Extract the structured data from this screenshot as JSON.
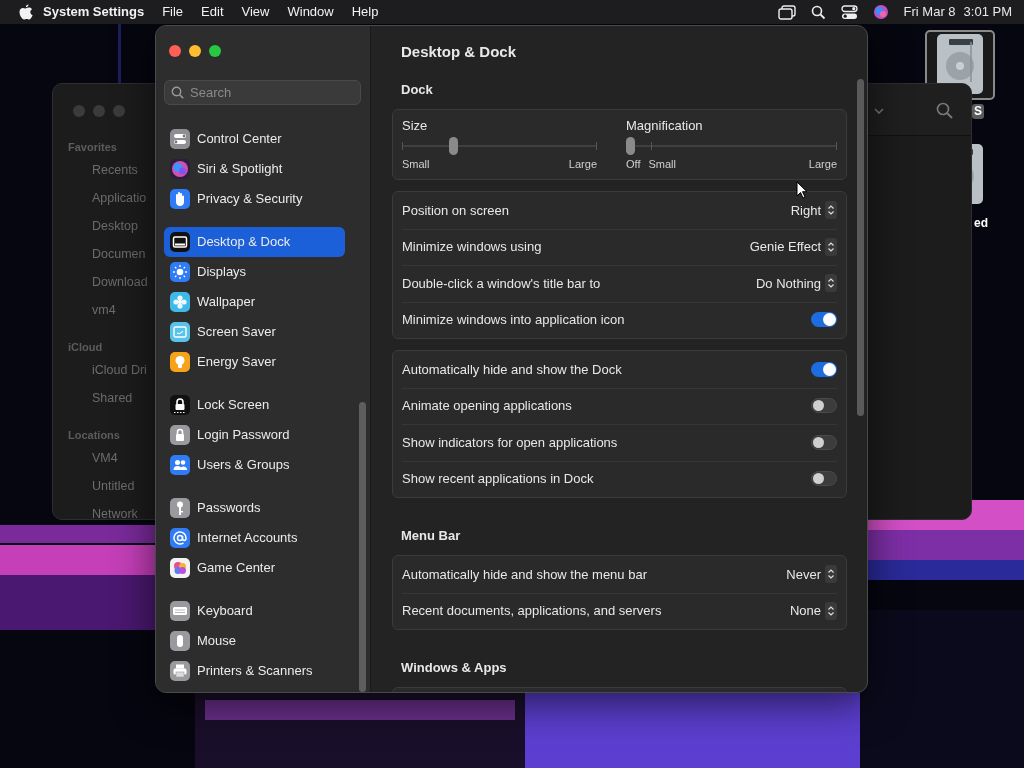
{
  "menu_bar": {
    "app": "System Settings",
    "menus": [
      "File",
      "Edit",
      "View",
      "Window",
      "Help"
    ],
    "date": "Fri Mar 8",
    "time": "3:01 PM"
  },
  "desktop_icons": [
    {
      "label": "S",
      "selected": true
    },
    {
      "label": "ed",
      "selected": false
    }
  ],
  "finder": {
    "sidebar": [
      {
        "heading": "Favorites",
        "items": [
          "Recents",
          "Applicatio",
          "Desktop",
          "Documen",
          "Download",
          "vm4"
        ]
      },
      {
        "heading": "iCloud",
        "items": [
          "iCloud Dri",
          "Shared"
        ]
      },
      {
        "heading": "Locations",
        "items": [
          "VM4",
          "Untitled",
          "Network"
        ]
      }
    ]
  },
  "settings": {
    "search": {
      "placeholder": "Search"
    },
    "sidebar": {
      "groups": [
        {
          "items": [
            {
              "label": "Control Center",
              "color": "#8e8e93",
              "selected": false
            },
            {
              "label": "Siri & Spotlight",
              "color": "#2a1f3d",
              "selected": false
            },
            {
              "label": "Privacy & Security",
              "color": "#2f7cf6",
              "selected": false
            }
          ]
        },
        {
          "items": [
            {
              "label": "Desktop & Dock",
              "color": "#111111",
              "selected": true
            },
            {
              "label": "Displays",
              "color": "#2f7cf6",
              "selected": false
            },
            {
              "label": "Wallpaper",
              "color": "#3fb9e8",
              "selected": false
            },
            {
              "label": "Screen Saver",
              "color": "#56c3ea",
              "selected": false
            },
            {
              "label": "Energy Saver",
              "color": "#f7a21b",
              "selected": false
            }
          ]
        },
        {
          "items": [
            {
              "label": "Lock Screen",
              "color": "#111111",
              "selected": false
            },
            {
              "label": "Login Password",
              "color": "#9a9a9e",
              "selected": false
            },
            {
              "label": "Users & Groups",
              "color": "#2f7cf6",
              "selected": false
            }
          ]
        },
        {
          "items": [
            {
              "label": "Passwords",
              "color": "#9a9a9e",
              "selected": false
            },
            {
              "label": "Internet Accounts",
              "color": "#2f7cf6",
              "selected": false
            },
            {
              "label": "Game Center",
              "color": "#f2f2f2",
              "selected": false
            }
          ]
        },
        {
          "items": [
            {
              "label": "Keyboard",
              "color": "#9a9a9e",
              "selected": false
            },
            {
              "label": "Mouse",
              "color": "#9a9a9e",
              "selected": false
            },
            {
              "label": "Printers & Scanners",
              "color": "#9a9a9e",
              "selected": false
            }
          ]
        }
      ]
    },
    "title": "Desktop & Dock",
    "sections": [
      {
        "heading": "Dock",
        "groups": [
          {
            "kind": "sliders",
            "sliders": [
              {
                "label": "Size",
                "level": 0.25,
                "labels": [
                  "Small",
                  "Large"
                ]
              },
              {
                "label": "Magnification",
                "level": 0,
                "labels": [
                  "Off",
                  "Small",
                  "Large"
                ]
              }
            ]
          },
          {
            "kind": "rows",
            "rows": [
              {
                "kind": "popup",
                "label": "Position on screen",
                "value": "Right"
              },
              {
                "kind": "popup",
                "label": "Minimize windows using",
                "value": "Genie Effect"
              },
              {
                "kind": "popup",
                "label": "Double-click a window's title bar to",
                "value": "Do Nothing"
              },
              {
                "kind": "toggle",
                "label": "Minimize windows into application icon",
                "on": true
              }
            ]
          },
          {
            "kind": "rows",
            "rows": [
              {
                "kind": "toggle",
                "label": "Automatically hide and show the Dock",
                "on": true
              },
              {
                "kind": "toggle",
                "label": "Animate opening applications",
                "on": false
              },
              {
                "kind": "toggle",
                "label": "Show indicators for open applications",
                "on": false
              },
              {
                "kind": "toggle",
                "label": "Show recent applications in Dock",
                "on": false
              }
            ]
          }
        ]
      },
      {
        "heading": "Menu Bar",
        "groups": [
          {
            "kind": "rows",
            "rows": [
              {
                "kind": "popup",
                "label": "Automatically hide and show the menu bar",
                "value": "Never"
              },
              {
                "kind": "popup",
                "label": "Recent documents, applications, and servers",
                "value": "None"
              }
            ]
          }
        ]
      },
      {
        "heading": "Windows & Apps"
      }
    ]
  }
}
